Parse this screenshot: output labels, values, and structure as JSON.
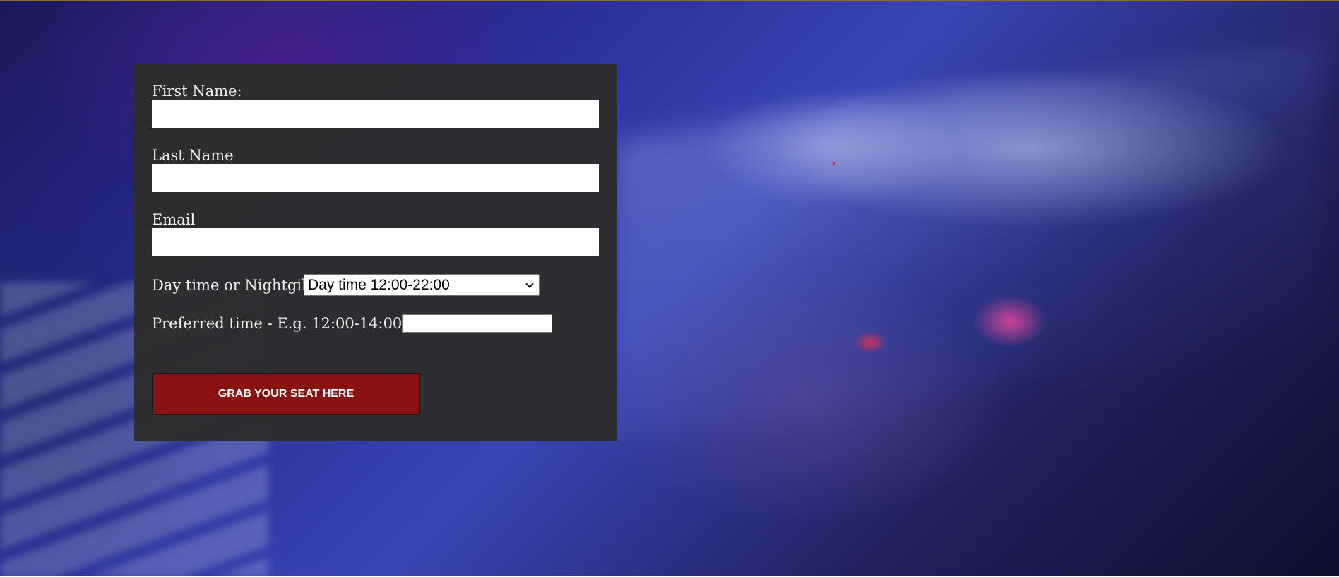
{
  "form": {
    "first_name": {
      "label": "First Name:",
      "value": ""
    },
    "last_name": {
      "label": "Last Name",
      "value": ""
    },
    "email": {
      "label": "Email",
      "value": ""
    },
    "shift": {
      "label": "Day time or Nightgib",
      "selected": "Day time 12:00-22:00"
    },
    "preferred_time": {
      "label": "Preferred time - E.g. 12:00-14:00",
      "value": ""
    },
    "submit_label": "GRAB YOUR SEAT HERE"
  },
  "colors": {
    "panel_background": "#2d2d2d",
    "button_background": "#8b1212",
    "label_text": "#f2f2f2"
  },
  "icons": {
    "select_arrow": "chevron-down-icon"
  }
}
